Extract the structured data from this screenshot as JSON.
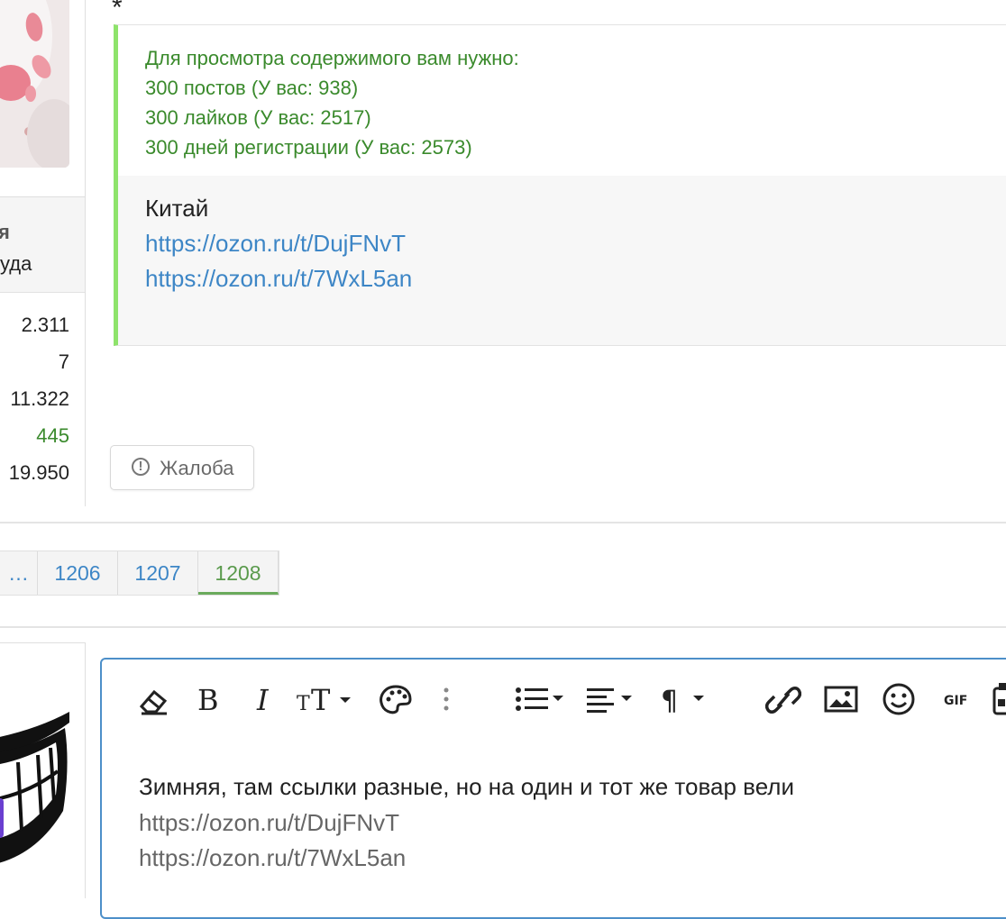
{
  "post": {
    "star": "*",
    "hide_notice": {
      "heading": "Для просмотра содержимого вам нужно:",
      "req_posts": "300 постов (У вас: 938)",
      "req_likes": "300 лайков (У вас: 2517)",
      "req_days": "300 дней регистрации (У вас: 2573)"
    },
    "content": {
      "label": "Китай",
      "link1": "https://ozon.ru/t/DujFNvT",
      "link2": "https://ozon.ru/t/7WxL5an"
    },
    "report_label": "Жалоба"
  },
  "user_stats": {
    "head_line1": "я",
    "head_line2": "уда",
    "values": [
      "2.311",
      "7",
      "11.322",
      "445",
      "19.950"
    ]
  },
  "pagination": {
    "dots": "…",
    "pages": [
      "1206",
      "1207",
      "1208"
    ],
    "current": "1208"
  },
  "editor": {
    "toolbar": [
      "eraser-icon",
      "bold-icon",
      "italic-icon",
      "text-size-icon",
      "palette-icon",
      "more-vertical-icon",
      "list-icon",
      "align-icon",
      "paragraph-icon",
      "link-icon",
      "image-icon",
      "smiley-icon",
      "gif-icon",
      "media-icon"
    ],
    "gif_label": "GIF",
    "text_line1": "Зимняя, там ссылки разные, но на один и тот же товар вели",
    "text_line2": "https://ozon.ru/t/DujFNvT",
    "text_line3": "https://ozon.ru/t/7WxL5an"
  },
  "colors": {
    "link": "#3d86c6",
    "notice_green": "#3a8a2c",
    "hide_border": "#8ee36b",
    "editor_border": "#4d8fc9"
  }
}
